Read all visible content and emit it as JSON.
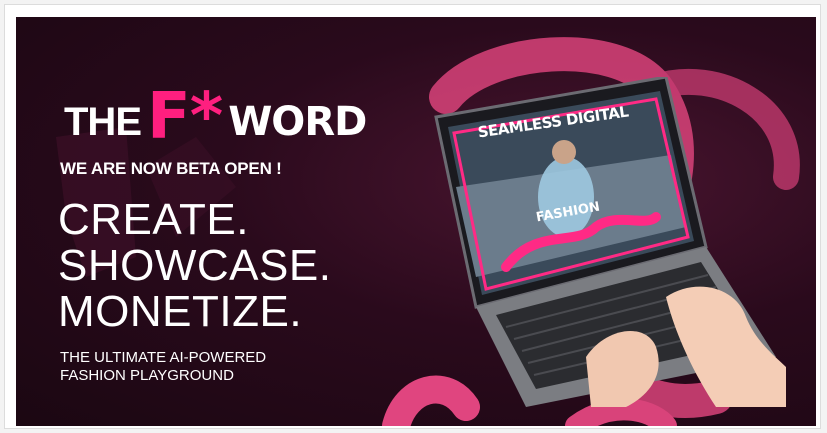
{
  "banner": {
    "logo": {
      "part1": "THE",
      "part2": "F*",
      "part3": "WORD"
    },
    "beta_text": "WE ARE NOW BETA OPEN !",
    "headline": [
      "CREATE.",
      "SHOWCASE.",
      "MONETIZE."
    ],
    "subheadline": [
      "THE ULTIMATE AI-POWERED",
      "FASHION PLAYGROUND"
    ],
    "screen": {
      "title": "SEAMLESS DIGITAL",
      "subtitle": "FASHION"
    }
  },
  "colors": {
    "background": "#1b0712",
    "accent": "#ff1f7f",
    "swirl": "#e0457f",
    "text": "#ffffff"
  },
  "icons": [
    "laptop-illustration",
    "ribbon-swirl"
  ]
}
